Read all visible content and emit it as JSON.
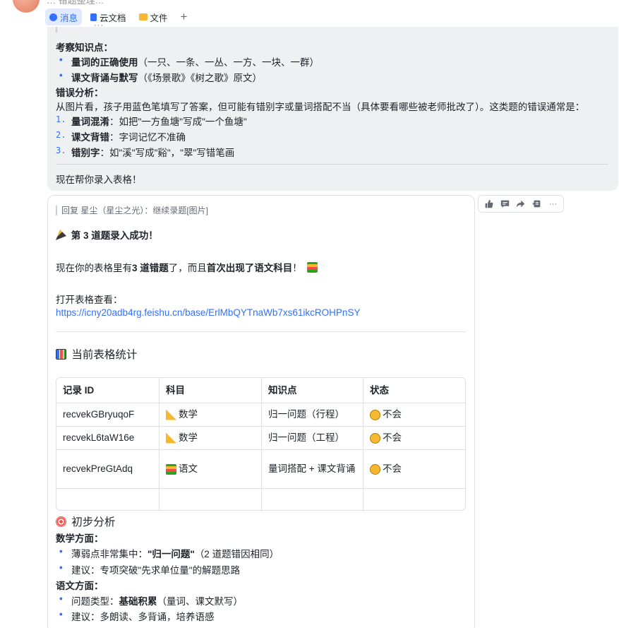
{
  "header": {
    "title_partial": "… 错题整理…",
    "tabs": [
      {
        "label": "消息",
        "icon": "chat-icon",
        "active": true
      },
      {
        "label": "云文档",
        "icon": "doc-icon",
        "active": false
      },
      {
        "label": "文件",
        "icon": "folder-icon",
        "active": false
      }
    ],
    "add_tab_label": "+"
  },
  "message1": {
    "ellipsis": "···",
    "knowledge_title": "考察知识点：",
    "knowledge_items": [
      {
        "bold": "量词的正确使用",
        "rest": "（一只、一条、一丛、一方、一块、一群）"
      },
      {
        "bold": "课文背诵与默写",
        "rest": "（《场景歌》《树之歌》原文）"
      }
    ],
    "error_title": "错误分析：",
    "error_intro": "从图片看，孩子用蓝色笔填写了答案，但可能有错别字或量词搭配不当（具体要看哪些被老师批改了）。这类题的错误通常是：",
    "error_items": [
      {
        "num": "1.",
        "bold": "量词混淆",
        "rest": "：如把\"一方鱼塘\"写成\"一个鱼塘\""
      },
      {
        "num": "2.",
        "bold": "课文背错",
        "rest": "：字词记忆不准确"
      },
      {
        "num": "3.",
        "bold": "错别字",
        "rest": "：如\"溪\"写成\"谿\"，\"翠\"写错笔画"
      }
    ],
    "footer": "现在帮你录入表格！"
  },
  "message2": {
    "reply_quote": "回复 星尘（星尘之光）：继续录题[图片]",
    "success_line": "第 3 道题录入成功！",
    "summary_pre": "现在你的表格里有",
    "summary_bold1": "3 道错题",
    "summary_mid": "了，而且",
    "summary_bold2": "首次出现了语文科目",
    "summary_post": "！",
    "open_label": "打开表格查看：",
    "url": "https://icny20adb4rg.feishu.cn/base/ErlMbQYTnaWb7xs61ikcROHPnSY",
    "stats_title": "当前表格统计",
    "table": {
      "headers": [
        "记录 ID",
        "科目",
        "知识点",
        "状态"
      ],
      "rows": [
        {
          "id": "recvekGBryuqoF",
          "subject": "数学",
          "subject_icon": "ruler-icon",
          "topic": "归一问题（行程）",
          "status": "不会"
        },
        {
          "id": "recvekL6taW16e",
          "subject": "数学",
          "subject_icon": "ruler-icon",
          "topic": "归一问题（工程）",
          "status": "不会"
        },
        {
          "id": "recvekPreGtAdq",
          "subject": "语文",
          "subject_icon": "books-icon",
          "topic": "量词搭配 + 课文背诵",
          "status": "不会"
        }
      ]
    },
    "analysis_title": "初步分析",
    "math_title": "数学方面：",
    "math_items": [
      {
        "pre": "薄弱点非常集中：",
        "bold": "\"归一问题\"",
        "rest": "（2 道题错因相同）"
      },
      {
        "pre": "建议：专项突破\"先求单位量\"的解题思路",
        "bold": "",
        "rest": ""
      }
    ],
    "chinese_title": "语文方面：",
    "chinese_items": [
      {
        "pre": "问题类型：",
        "bold": "基础积累",
        "rest": "（量词、课文默写）"
      },
      {
        "pre": "建议：多朗读、多背诵，培养语感",
        "bold": "",
        "rest": ""
      }
    ]
  },
  "actions": [
    {
      "icon": "thumbs-up-icon"
    },
    {
      "icon": "comment-icon"
    },
    {
      "icon": "forward-icon"
    },
    {
      "icon": "quote-icon"
    },
    {
      "icon": "more-icon",
      "label": "···"
    }
  ],
  "colors": {
    "accent": "#3370ff",
    "bubble_bg": "#eff0f1",
    "text": "#1f2329"
  }
}
